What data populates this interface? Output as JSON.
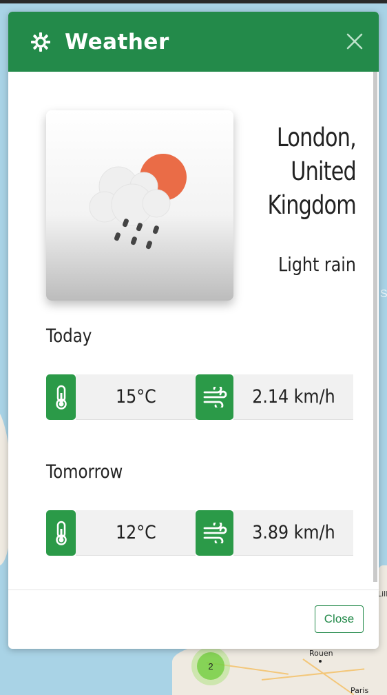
{
  "modal": {
    "title": "Weather",
    "close_label": "Close"
  },
  "current": {
    "location_line1": "London,",
    "location_line2": "United",
    "location_line3": "Kingdom",
    "condition": "Light rain",
    "icon": "cloud-sun-rain-icon"
  },
  "forecast": [
    {
      "day": "Today",
      "temperature": "15°C",
      "wind": "2.14 km/h"
    },
    {
      "day": "Tomorrow",
      "temperature": "12°C",
      "wind": "3.89 km/h"
    }
  ],
  "map": {
    "city_label_1": "Rouen",
    "city_label_2": "Lille",
    "city_label_3": "Paris",
    "cluster_count": "2"
  },
  "colors": {
    "header_green": "#238a4a",
    "icon_green": "#2b9a48",
    "sun_orange": "#ea6c47"
  }
}
